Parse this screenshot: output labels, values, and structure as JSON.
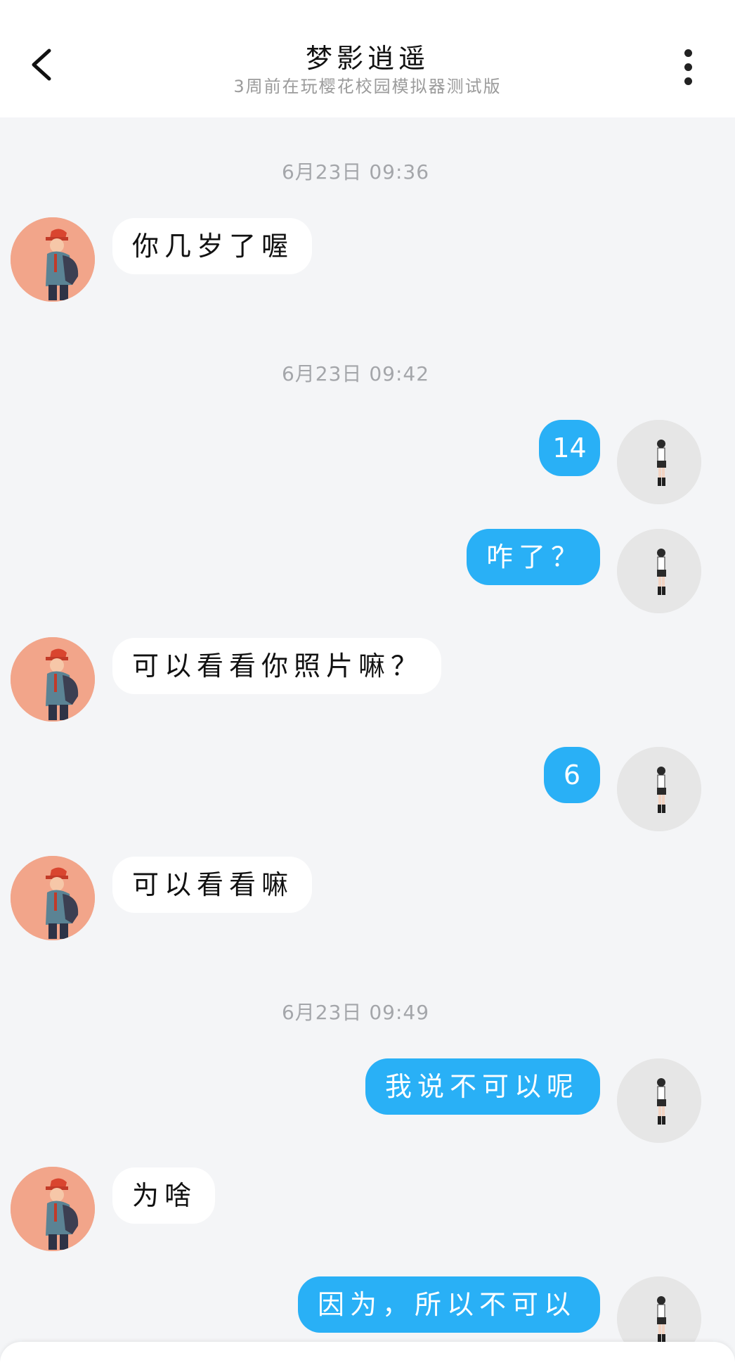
{
  "header": {
    "title": "梦影逍遥",
    "subtitle": "3周前在玩樱花校园模拟器测试版",
    "back_icon": "chevron-left-icon",
    "more_icon": "more-vertical-icon"
  },
  "colors": {
    "background": "#F4F5F7",
    "header_bg": "#FFFFFF",
    "sent_bubble": "#29B0F6",
    "received_bubble": "#FFFFFF",
    "timestamp_text": "#A4A6AA"
  },
  "messages": {
    "t1": "6月23日 09:36",
    "m1": "你几岁了喔",
    "t2": "6月23日 09:42",
    "m2": "14",
    "m3": "咋了？",
    "m4": "可以看看你照片嘛？",
    "m5": "6",
    "m6": "可以看看嘛",
    "t3": "6月23日 09:49",
    "m7": "我说不可以呢",
    "m8": "为啥",
    "m9": "因为，所以不可以"
  }
}
